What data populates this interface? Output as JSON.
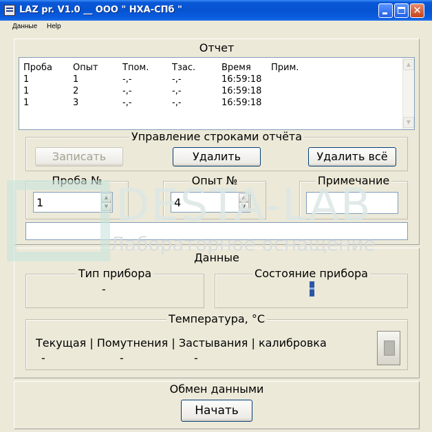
{
  "window": {
    "title": "LAZ pr. V1.0 __ ООО \" НХА-СПб \"",
    "close_glyph": "✕"
  },
  "menu": {
    "items": [
      "Данные",
      "Help"
    ]
  },
  "report": {
    "title": "Отчет",
    "columns": [
      "Проба",
      "Опыт",
      "Tпом.",
      "Tзас.",
      "Время",
      "Прим."
    ],
    "rows": [
      [
        "1",
        "1",
        "-,-",
        "-,-",
        "16:59:18",
        ""
      ],
      [
        "1",
        "2",
        "-,-",
        "-,-",
        "16:59:18",
        ""
      ],
      [
        "1",
        "3",
        "-,-",
        "-,-",
        "16:59:18",
        ""
      ]
    ]
  },
  "row_control": {
    "title": "Управление строками отчёта",
    "write_label": "Записать",
    "delete_label": "Удалить",
    "delete_all_label": "Удалить всё"
  },
  "sample": {
    "title": "Проба №",
    "value": "1"
  },
  "experiment": {
    "title": "Опыт №",
    "value": "4"
  },
  "note": {
    "title": "Примечание",
    "value": ""
  },
  "data_section": {
    "title": "Данные",
    "device_type_title": "Тип прибора",
    "device_type_value": "-",
    "device_state_title": "Состояние прибора"
  },
  "temperature": {
    "title": "Температура, °C",
    "header": "Текущая | Помутнения | Застывания |  калибровка",
    "current": "-",
    "cloud": "-",
    "pour": "-"
  },
  "exchange": {
    "title": "Обмен данными",
    "start_label": "Начать"
  },
  "watermark": {
    "text": "DESTA-LAB",
    "subtitle": "Лабораторное оснащение"
  },
  "colors": {
    "title_bar": "#0553d0",
    "face": "#ece9d8",
    "field_border": "#7f9db9"
  }
}
